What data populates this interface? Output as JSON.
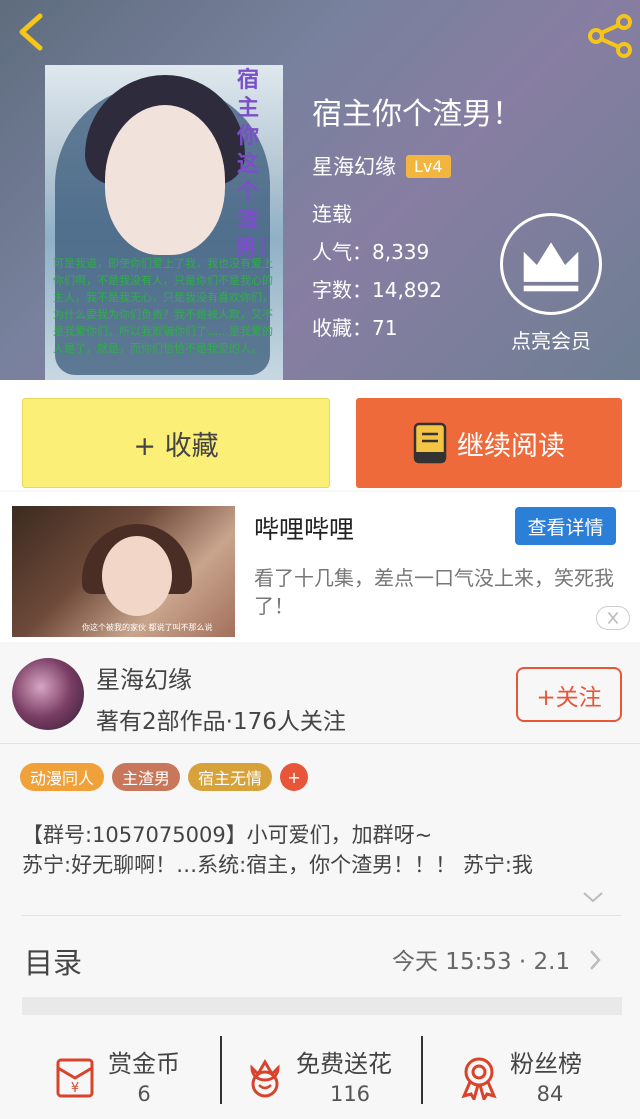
{
  "book": {
    "cover_title": "宿主你这个渣男！",
    "cover_text": "可是我道，即使你们爱上了我，我也没有爱上你们啊，不是我没有人，只是你们不是我心的主人，我不是我无心，只是我没有喜欢你们，为什么要我为你们负责？我不是被人欺，又不是我爱你们，所以我欺骗你们了……是我爱的人是了，就是，而你们恰恰不是我爱的人。",
    "title": "宿主你个渣男！",
    "author": "星海幻缘",
    "level": "Lv4",
    "status": "连载",
    "popularity": "人气：8,339",
    "words": "字数：14,892",
    "favorites": "收藏：71"
  },
  "vip": {
    "label": "点亮会员"
  },
  "actions": {
    "collect": "+ 收藏",
    "read": "继续阅读"
  },
  "ad": {
    "title": "哔哩哔哩",
    "detail_button": "查看详情",
    "description": "看了十几集，差点一口气没上来，笑死我了！",
    "image_caption": "你这个被我的家伙 都说了叫不那么说"
  },
  "author_card": {
    "name": "星海幻缘",
    "stats": "著有2部作品·176人关注",
    "follow": "+关注"
  },
  "tags": [
    {
      "label": "动漫同人",
      "color": "#f0a13a"
    },
    {
      "label": "主渣男",
      "color": "#c8775a"
    },
    {
      "label": "宿主无情",
      "color": "#d7a23a"
    }
  ],
  "tag_plus": "+",
  "intro": {
    "line1": "【群号:1057075009】小可爱们，加群呀~",
    "line2": "苏宁:好无聊啊！…系统:宿主，你个渣男！！！ 苏宁:我"
  },
  "toc": {
    "label": "目录",
    "update": "今天 15:53 · 2.1"
  },
  "bottom": {
    "reward": {
      "label": "赏金币",
      "count": "6"
    },
    "flower": {
      "label": "免费送花",
      "count": "116"
    },
    "fans": {
      "label": "粉丝榜",
      "count": "84"
    }
  },
  "colors": {
    "accent": "#ee6a3a",
    "collect_bg": "#fbef78",
    "ad_button": "#2b7fd6"
  }
}
